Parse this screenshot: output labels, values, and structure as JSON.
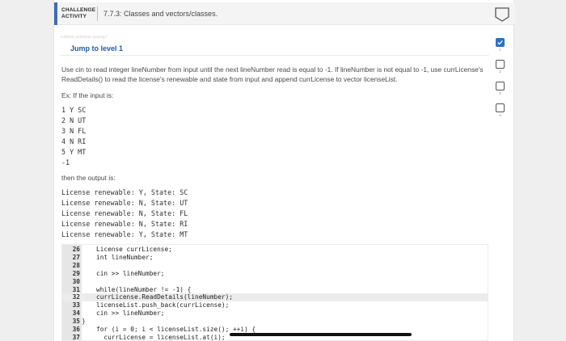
{
  "header": {
    "badge_line1": "CHALLENGE",
    "badge_line2": "ACTIVITY",
    "title": "7.7.3: Classes and vectors/classes."
  },
  "activity_id": "449020.3294042.qx3zqy7",
  "jump_link": "Jump to level 1",
  "instructions": "Use cin to read integer lineNumber from input until the next lineNumber read is equal to -1. If lineNumber is not equal to -1, use currLicense's ReadDetails() to read the license's renewable and state from input and append currLicense to vector licenseList.",
  "example_intro": "Ex: If the input is:",
  "input_lines": [
    "1 Y SC",
    "2 N UT",
    "3 N FL",
    "4 N RI",
    "5 Y MT",
    "-1"
  ],
  "output_intro": "then the output is:",
  "output_lines": [
    "License renewable: Y, State: SC",
    "License renewable: N, State: UT",
    "License renewable: N, State: FL",
    "License renewable: N, State: RI",
    "License renewable: Y, State: MT"
  ],
  "code_lines": [
    {
      "n": "26",
      "src": "License currLicense;",
      "hl": false,
      "brace": ""
    },
    {
      "n": "27",
      "src": "int lineNumber;",
      "hl": false,
      "brace": ""
    },
    {
      "n": "28",
      "src": "",
      "hl": false,
      "brace": ""
    },
    {
      "n": "29",
      "src": "cin >> lineNumber;",
      "hl": false,
      "brace": ""
    },
    {
      "n": "30",
      "src": "",
      "hl": false,
      "brace": ""
    },
    {
      "n": "31",
      "src": "while(lineNumber != -1) {",
      "hl": false,
      "brace": ""
    },
    {
      "n": "32",
      "src": "currLicense.ReadDetails(lineNumber);",
      "hl": true,
      "brace": ""
    },
    {
      "n": "33",
      "src": "licenseList.push_back(currLicense);",
      "hl": false,
      "brace": ""
    },
    {
      "n": "34",
      "src": "cin >> lineNumber;",
      "hl": false,
      "brace": ""
    },
    {
      "n": "35",
      "src": "",
      "hl": false,
      "brace": "}"
    },
    {
      "n": "36",
      "src": "for (i = 0; i < licenseList.size(); ++i) {",
      "hl": false,
      "brace": ""
    },
    {
      "n": "37",
      "src": "  currLicense = licenseList.at(i);",
      "hl": false,
      "brace": ""
    }
  ],
  "steps": [
    {
      "num": "1",
      "done": true
    },
    {
      "num": "2",
      "done": false
    },
    {
      "num": "3",
      "done": false
    },
    {
      "num": "4",
      "done": false
    }
  ],
  "colors": {
    "accent": "#3f6fb2",
    "link": "#1f5aa6",
    "step_done": "#2a6fc9"
  }
}
